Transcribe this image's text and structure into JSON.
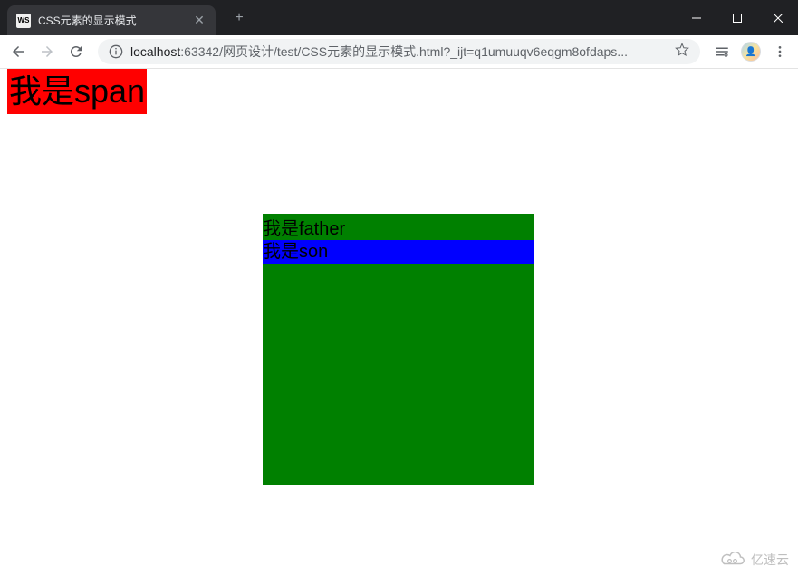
{
  "window": {
    "tab_title": "CSS元素的显示模式",
    "favicon_text": "WS",
    "minimize_icon": "minimize",
    "maximize_icon": "maximize",
    "close_icon": "close",
    "new_tab": "+"
  },
  "toolbar": {
    "back": "←",
    "forward": "→",
    "reload": "↻",
    "url_host": "localhost",
    "url_rest": ":63342/网页设计/test/CSS元素的显示模式.html?_ijt=q1umuuqv6eqgm8ofdaps...",
    "star": "☆",
    "menu": "⋮"
  },
  "page": {
    "span_text": "我是span",
    "father_text": "我是father",
    "son_text": "我是son"
  },
  "watermark": {
    "text": "亿速云"
  }
}
